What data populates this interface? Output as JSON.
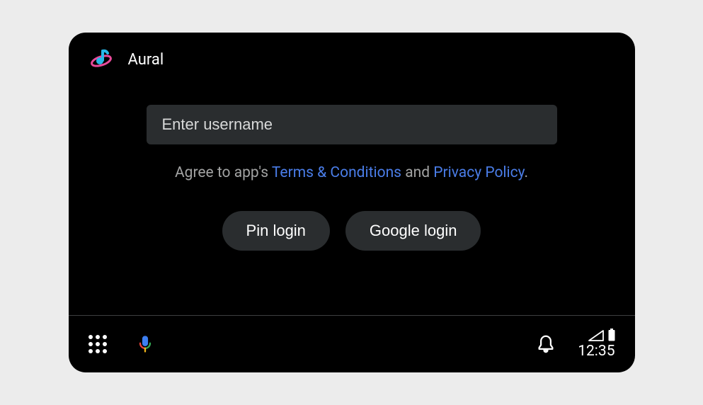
{
  "header": {
    "app_title": "Aural"
  },
  "login": {
    "username_placeholder": "Enter username",
    "agreement_prefix": "Agree to app's ",
    "terms_label": "Terms & Conditions",
    "agreement_middle": " and ",
    "privacy_label": "Privacy Policy",
    "agreement_suffix": ".",
    "pin_button_label": "Pin login",
    "google_button_label": "Google login"
  },
  "navbar": {
    "clock": "12:35"
  }
}
